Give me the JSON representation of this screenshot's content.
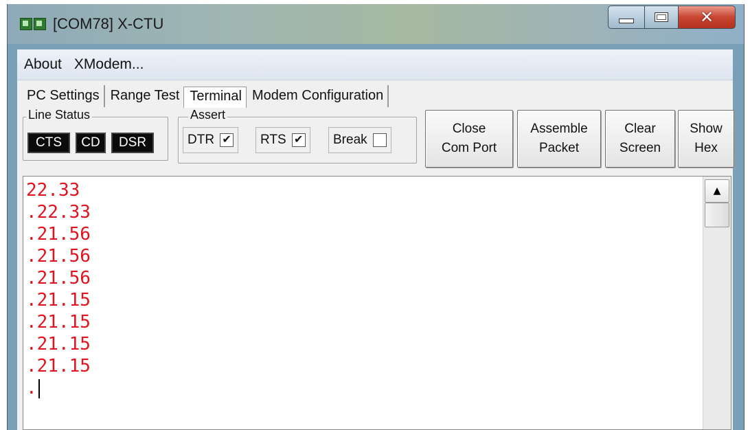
{
  "window": {
    "title": "[COM78] X-CTU"
  },
  "menu": {
    "items": [
      "About",
      "XModem..."
    ]
  },
  "tabs": [
    {
      "label": "PC Settings",
      "active": false
    },
    {
      "label": "Range Test",
      "active": false
    },
    {
      "label": "Terminal",
      "active": true
    },
    {
      "label": "Modem Configuration",
      "active": false
    }
  ],
  "line_status": {
    "label": "Line Status",
    "indicators": [
      "CTS",
      "CD",
      "DSR"
    ]
  },
  "assert": {
    "label": "Assert",
    "items": [
      {
        "label": "DTR",
        "checked": true
      },
      {
        "label": "RTS",
        "checked": true
      },
      {
        "label": "Break",
        "checked": false
      }
    ]
  },
  "buttons": {
    "close_com_port": "Close\nCom Port",
    "assemble_packet": "Assemble\nPacket",
    "clear_screen": "Clear\nScreen",
    "show_hex": "Show\nHex"
  },
  "terminal": {
    "text_color": "#e0141e",
    "lines": [
      "22.33",
      ".22.33",
      ".21.56",
      ".21.56",
      ".21.56",
      ".21.15",
      ".21.15",
      ".21.15",
      ".21.15",
      "."
    ]
  }
}
